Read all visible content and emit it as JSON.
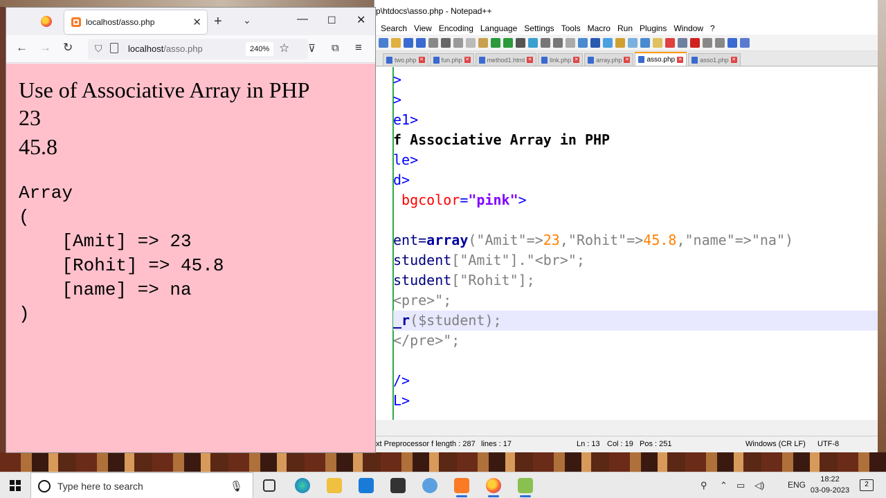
{
  "firefox": {
    "tab_title": "localhost/asso.php",
    "url_host": "localhost",
    "url_path": "/asso.php",
    "zoom": "240%",
    "page": {
      "heading": "Use of Associative Array in PHP",
      "line1": "23",
      "line2": "45.8",
      "pre_lines": [
        "Array",
        "(",
        "    [Amit] => 23",
        "    [Rohit] => 45.8",
        "    [name] => na",
        ")"
      ]
    }
  },
  "notepad": {
    "title": "p\\htdocs\\asso.php - Notepad++",
    "menu": [
      "Search",
      "View",
      "Encoding",
      "Language",
      "Settings",
      "Tools",
      "Macro",
      "Run",
      "Plugins",
      "Window",
      "?"
    ],
    "tabs": [
      {
        "label": "two.php",
        "active": false
      },
      {
        "label": "fun.php",
        "active": false
      },
      {
        "label": "method1.html",
        "active": false
      },
      {
        "label": "link.php",
        "active": false
      },
      {
        "label": "array.php",
        "active": false
      },
      {
        "label": "asso.php",
        "active": true
      },
      {
        "label": "asso1.php",
        "active": false
      }
    ],
    "code": {
      "l1": ">",
      "l2": ">",
      "l3": "e1>",
      "l4": "f Associative Array in PHP",
      "l5": "le>",
      "l6": "d>",
      "l7_attr": "bgcolor",
      "l7_val": "\"pink\"",
      "l9_a": "ent=",
      "l9_kw": "array",
      "l9_rest1": "(\"Amit\"=>",
      "l9_n1": "23",
      "l9_rest2": ",\"Rohit\"=>",
      "l9_n2": "45.8",
      "l9_rest3": ",\"name\"=>\"na\")",
      "l10_a": "student",
      "l10_b": "[\"Amit\"].\"<br>\";",
      "l11_a": "student",
      "l11_b": "[\"Rohit\"];",
      "l12": "<pre>\";",
      "l13_a": "_r",
      "l13_b": "($student);",
      "l14": "</pre>\";",
      "l16": "/>",
      "l17": "L>"
    },
    "status": {
      "type": "xt Preprocessor f length : 287",
      "lines": "lines : 17",
      "ln": "Ln : 13",
      "col": "Col : 19",
      "pos": "Pos : 251",
      "eol": "Windows (CR LF)",
      "enc": "UTF-8"
    }
  },
  "taskbar": {
    "search_placeholder": "Type here to search",
    "lang": "ENG",
    "time": "18:22",
    "date": "03-09-2023",
    "notif_count": "2"
  }
}
